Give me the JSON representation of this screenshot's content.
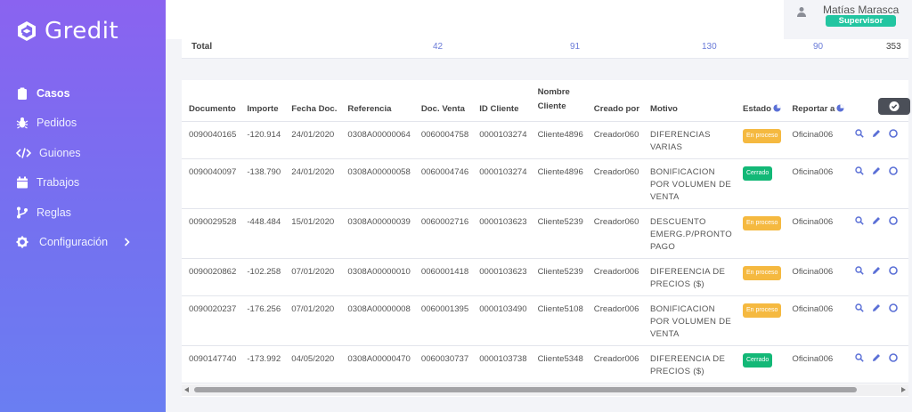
{
  "app": {
    "brand": "Gredit"
  },
  "sidebar": {
    "items": [
      {
        "label": "Casos",
        "icon": "clipboard-icon",
        "active": true
      },
      {
        "label": "Pedidos",
        "icon": "bug-icon"
      },
      {
        "label": "Guiones",
        "icon": "code-icon"
      },
      {
        "label": "Trabajos",
        "icon": "calendar-icon"
      },
      {
        "label": "Reglas",
        "icon": "branch-icon"
      },
      {
        "label": "Configuración",
        "icon": "gear-icon",
        "has_chevron": true
      }
    ]
  },
  "user": {
    "name": "Matías Marasca",
    "role": "Supervisor",
    "icon": "user-icon"
  },
  "totals": {
    "label": "Total",
    "values": [
      "42",
      "91",
      "130",
      "90",
      "353"
    ]
  },
  "table": {
    "headers": {
      "documento": "Documento",
      "importe": "Importe",
      "fecha_doc": "Fecha Doc.",
      "referencia": "Referencia",
      "doc_venta": "Doc. Venta",
      "id_cliente": "ID Cliente",
      "nombre_cliente": "Nombre Cliente",
      "creado_por": "Creado por",
      "motivo": "Motivo",
      "estado": "Estado",
      "reportar_a": "Reportar a"
    },
    "rows": [
      {
        "documento": "0090040165",
        "importe": "-120.914",
        "fecha_doc": "24/01/2020",
        "referencia": "0308A00000064",
        "doc_venta": "0060004758",
        "id_cliente": "0000103274",
        "nombre_cliente": "Cliente4896",
        "creado_por": "Creador060",
        "motivo": "Diferencias varias",
        "estado": "En proceso",
        "reportar_a": "Oficina006"
      },
      {
        "documento": "0090040097",
        "importe": "-138.790",
        "fecha_doc": "24/01/2020",
        "referencia": "0308A00000058",
        "doc_venta": "0060004746",
        "id_cliente": "0000103274",
        "nombre_cliente": "Cliente4896",
        "creado_por": "Creador060",
        "motivo": "Bonificacion por volumen de venta",
        "estado": "Cerrado",
        "reportar_a": "Oficina006"
      },
      {
        "documento": "0090029528",
        "importe": "-448.484",
        "fecha_doc": "15/01/2020",
        "referencia": "0308A00000039",
        "doc_venta": "0060002716",
        "id_cliente": "0000103623",
        "nombre_cliente": "Cliente5239",
        "creado_por": "Creador060",
        "motivo": "Descuento emerg.p/pronto pago",
        "estado": "En proceso",
        "reportar_a": "Oficina006"
      },
      {
        "documento": "0090020862",
        "importe": "-102.258",
        "fecha_doc": "07/01/2020",
        "referencia": "0308A00000010",
        "doc_venta": "0060001418",
        "id_cliente": "0000103623",
        "nombre_cliente": "Cliente5239",
        "creado_por": "Creador006",
        "motivo": "Difereencia de precios ($)",
        "estado": "En proceso",
        "reportar_a": "Oficina006"
      },
      {
        "documento": "0090020237",
        "importe": "-176.256",
        "fecha_doc": "07/01/2020",
        "referencia": "0308A00000008",
        "doc_venta": "0060001395",
        "id_cliente": "0000103490",
        "nombre_cliente": "Cliente5108",
        "creado_por": "Creador006",
        "motivo": "Bonificacion por volumen de venta",
        "estado": "En proceso",
        "reportar_a": "Oficina006"
      },
      {
        "documento": "0090147740",
        "importe": "-173.992",
        "fecha_doc": "04/05/2020",
        "referencia": "0308A00000470",
        "doc_venta": "0060030737",
        "id_cliente": "0000103738",
        "nombre_cliente": "Cliente5348",
        "creado_por": "Creador006",
        "motivo": "Difereencia de precios ($)",
        "estado": "Cerrado",
        "reportar_a": "Oficina006"
      }
    ],
    "row_actions": [
      "search-icon",
      "edit-icon",
      "more-icon"
    ]
  },
  "colors": {
    "accent": "#6a7bd8",
    "in_progress": "#f5b940",
    "closed": "#13b877",
    "role_badge": "#22c5a1"
  }
}
